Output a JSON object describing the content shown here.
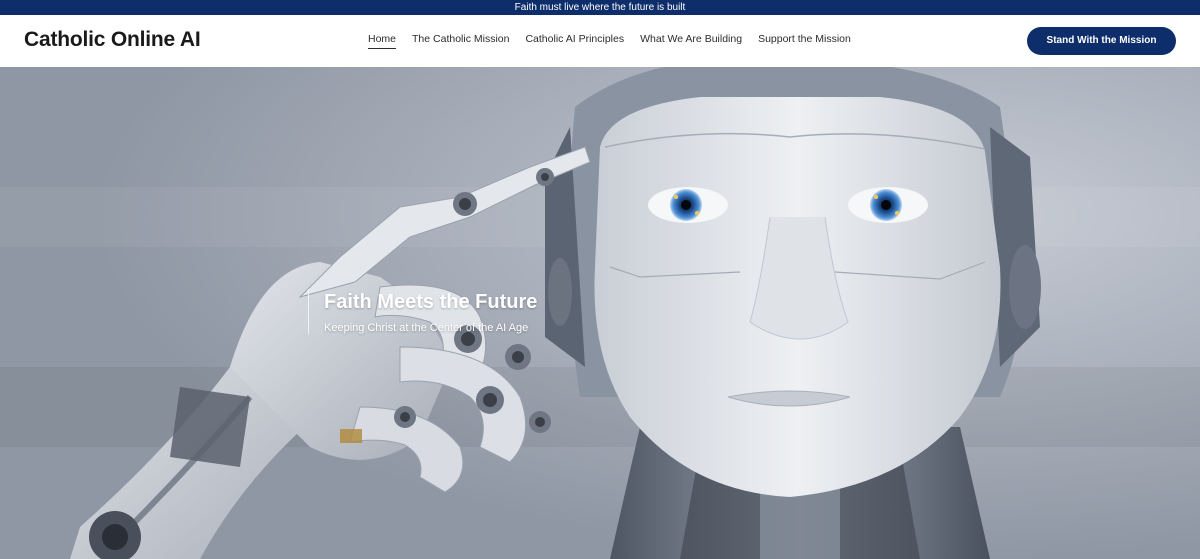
{
  "announcement": {
    "text": "Faith must live where the future is built"
  },
  "header": {
    "logo": "Catholic Online AI",
    "nav": [
      {
        "label": "Home",
        "active": true
      },
      {
        "label": "The Catholic Mission",
        "active": false
      },
      {
        "label": "Catholic AI Principles",
        "active": false
      },
      {
        "label": "What We Are Building",
        "active": false
      },
      {
        "label": "Support the Mission",
        "active": false
      }
    ],
    "cta_label": "Stand With the Mission"
  },
  "hero": {
    "title": "Faith Meets the Future",
    "subtitle": "Keeping Christ at the Center of the AI Age",
    "image_icon": "humanoid-robot-image"
  },
  "colors": {
    "brand_navy": "#0d2d6b",
    "text_dark": "#1a1a1a",
    "hero_text": "#ffffff"
  }
}
